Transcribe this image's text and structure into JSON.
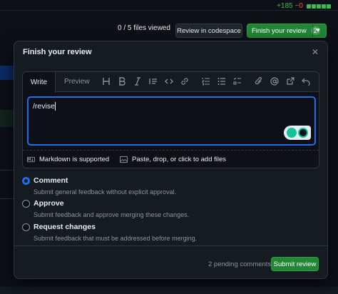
{
  "header": {
    "additions": "+185",
    "deletions": "−0",
    "files_viewed": "0 / 5 files viewed",
    "codespace_label": "Review in codespace",
    "finish_label": "Finish your review",
    "finish_count": "2"
  },
  "modal": {
    "title": "Finish your review",
    "close_icon": "close-icon",
    "tabs": {
      "write": "Write",
      "preview": "Preview"
    },
    "toolbar_icons": [
      "heading-icon",
      "bold-icon",
      "italic-icon",
      "quote-icon",
      "code-icon",
      "link-icon",
      "ordered-list-icon",
      "unordered-list-icon",
      "task-list-icon",
      "attach-icon",
      "mention-icon",
      "reference-icon",
      "undo-icon"
    ],
    "comment_value": "/revise",
    "footer": {
      "markdown": "Markdown is supported",
      "attach": "Paste, drop, or click to add files"
    },
    "options": [
      {
        "label": "Comment",
        "description": "Submit general feedback without explicit approval.",
        "checked": true
      },
      {
        "label": "Approve",
        "description": "Submit feedback and approve merging these changes.",
        "checked": false
      },
      {
        "label": "Request changes",
        "description": "Submit feedback that must be addressed before merging.",
        "checked": false
      }
    ],
    "pending": "2 pending comments",
    "submit_label": "Submit review"
  },
  "colors": {
    "accent": "#1f6feb",
    "primary_button": "#238636",
    "background": "#0d1117",
    "surface": "#161b22"
  }
}
